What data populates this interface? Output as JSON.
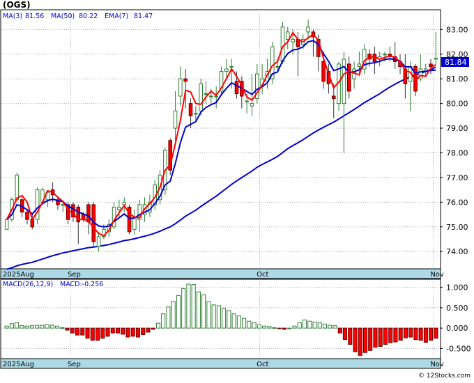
{
  "header": {
    "ticker": "(OGS)",
    "legend": [
      "MA(3)",
      "81.56",
      "MA(50)",
      "80.22",
      "EMA(7)",
      "81.47"
    ]
  },
  "price_badge": "81.84",
  "macd_legend": [
    "MACD(26,12,9)",
    "MACD:-0.256"
  ],
  "watermark": "© 12Stocks.com",
  "colors": {
    "ma3": "#ff0000",
    "ma50": "#0000cc",
    "ema7": "#0000cc",
    "up": "#2e7d32",
    "down": "#ff0000",
    "badge": "#0000cc",
    "band": "#add8e6"
  },
  "chart_data": [
    {
      "type": "candlestick",
      "title": "(OGS)",
      "x_labels": [
        "2025Aug",
        "Sep",
        "Oct",
        "Nov"
      ],
      "ylim": [
        73.3,
        83.8
      ],
      "yticks": [
        74.0,
        75.0,
        76.0,
        77.0,
        78.0,
        79.0,
        80.0,
        81.0,
        82.0,
        83.0
      ],
      "grid": true,
      "candles": [
        [
          74.9,
          75.3,
          75.05,
          75.35
        ],
        [
          75.3,
          76.1,
          75.2,
          76.2
        ],
        [
          76.1,
          77.1,
          76.0,
          77.2
        ],
        [
          76.1,
          75.6,
          75.4,
          76.2
        ],
        [
          75.6,
          75.3,
          75.1,
          75.7
        ],
        [
          75.3,
          75.0,
          74.9,
          75.5
        ],
        [
          75.3,
          76.5,
          75.1,
          76.6
        ],
        [
          76.0,
          76.5,
          75.9,
          76.6
        ],
        [
          76.1,
          76.4,
          75.8,
          76.5
        ],
        [
          76.5,
          76.3,
          76.0,
          76.8
        ],
        [
          76.1,
          75.9,
          75.7,
          76.2
        ],
        [
          75.9,
          75.9,
          75.6,
          76.0
        ],
        [
          75.9,
          75.3,
          75.1,
          76.0
        ],
        [
          75.9,
          75.4,
          75.2,
          76.0
        ],
        [
          75.8,
          75.2,
          74.3,
          75.9
        ],
        [
          75.5,
          75.3,
          75.2,
          75.6
        ],
        [
          75.9,
          75.2,
          74.7,
          76.0
        ],
        [
          75.9,
          74.4,
          74.2,
          76.0
        ],
        [
          74.2,
          74.6,
          74.0,
          74.8
        ],
        [
          74.6,
          74.9,
          74.5,
          75.1
        ],
        [
          74.8,
          75.1,
          74.6,
          75.3
        ],
        [
          75.0,
          75.8,
          74.9,
          76.0
        ],
        [
          75.7,
          75.8,
          75.4,
          76.1
        ],
        [
          75.9,
          76.0,
          75.6,
          76.2
        ],
        [
          75.8,
          74.8,
          74.7,
          75.9
        ],
        [
          74.9,
          75.4,
          74.7,
          75.7
        ],
        [
          75.3,
          75.9,
          74.8,
          76.1
        ],
        [
          75.5,
          75.9,
          75.2,
          76.2
        ],
        [
          75.6,
          76.0,
          75.4,
          76.3
        ],
        [
          75.9,
          76.7,
          75.7,
          76.9
        ],
        [
          76.1,
          77.1,
          75.9,
          77.3
        ],
        [
          76.5,
          78.1,
          76.3,
          78.2
        ],
        [
          78.5,
          77.3,
          77.1,
          78.6
        ],
        [
          79.0,
          79.7,
          78.5,
          80.5
        ],
        [
          80.3,
          81.0,
          79.9,
          81.5
        ],
        [
          81.0,
          80.9,
          79.8,
          81.4
        ],
        [
          80.0,
          79.5,
          79.0,
          80.2
        ],
        [
          79.6,
          79.6,
          79.3,
          79.9
        ],
        [
          79.7,
          80.8,
          79.5,
          81.0
        ],
        [
          80.4,
          80.4,
          80.0,
          80.9
        ],
        [
          80.3,
          80.3,
          80.0,
          80.6
        ],
        [
          80.3,
          80.3,
          79.8,
          80.7
        ],
        [
          80.5,
          81.3,
          80.3,
          81.5
        ],
        [
          81.3,
          81.4,
          81.0,
          81.8
        ],
        [
          81.5,
          81.5,
          80.6,
          81.8
        ],
        [
          80.9,
          80.4,
          80.2,
          81.3
        ],
        [
          80.9,
          80.3,
          79.8,
          81.1
        ],
        [
          80.1,
          80.1,
          79.6,
          80.4
        ],
        [
          79.9,
          80.0,
          79.5,
          81.2
        ],
        [
          80.2,
          81.2,
          80.0,
          81.6
        ],
        [
          80.7,
          81.0,
          80.4,
          81.6
        ],
        [
          80.9,
          81.3,
          80.6,
          81.8
        ],
        [
          81.0,
          82.3,
          80.8,
          82.5
        ],
        [
          81.5,
          81.5,
          81.3,
          81.8
        ],
        [
          81.7,
          83.1,
          81.6,
          83.3
        ],
        [
          82.6,
          82.9,
          82.2,
          83.1
        ],
        [
          82.5,
          82.6,
          82.0,
          83.0
        ],
        [
          82.6,
          82.3,
          81.1,
          82.9
        ],
        [
          82.4,
          82.6,
          82.2,
          82.8
        ],
        [
          82.9,
          83.1,
          82.6,
          83.4
        ],
        [
          82.9,
          82.7,
          81.9,
          83.0
        ],
        [
          82.6,
          81.9,
          81.3,
          82.8
        ],
        [
          81.7,
          80.9,
          80.6,
          82.1
        ],
        [
          81.3,
          80.8,
          80.4,
          81.6
        ],
        [
          80.3,
          80.2,
          79.4,
          80.8
        ],
        [
          80.0,
          81.6,
          79.7,
          81.7
        ],
        [
          80.0,
          81.8,
          78.0,
          82.1
        ],
        [
          81.6,
          80.5,
          80.2,
          81.9
        ],
        [
          81.0,
          81.4,
          80.6,
          81.7
        ],
        [
          81.5,
          81.6,
          81.1,
          82.1
        ],
        [
          81.4,
          82.2,
          81.2,
          82.4
        ],
        [
          82.0,
          81.8,
          81.5,
          82.2
        ],
        [
          82.0,
          81.7,
          81.2,
          82.3
        ],
        [
          81.8,
          81.9,
          81.5,
          82.1
        ],
        [
          82.0,
          82.0,
          81.7,
          82.1
        ],
        [
          82.0,
          81.9,
          81.7,
          82.3
        ],
        [
          81.9,
          81.7,
          81.4,
          82.5
        ],
        [
          81.7,
          81.5,
          81.2,
          82.0
        ],
        [
          81.4,
          80.8,
          80.2,
          82.0
        ],
        [
          80.9,
          81.5,
          79.7,
          81.7
        ],
        [
          81.5,
          80.5,
          80.3,
          81.6
        ],
        [
          81.0,
          81.4,
          80.9,
          82.0
        ],
        [
          81.3,
          81.4,
          81.1,
          81.6
        ],
        [
          81.6,
          81.5,
          81.2,
          81.8
        ],
        [
          81.8,
          81.84,
          81.6,
          82.9
        ]
      ],
      "series": [
        {
          "name": "MA(3)",
          "last": 81.56
        },
        {
          "name": "MA(50)",
          "last": 80.22
        },
        {
          "name": "EMA(7)",
          "last": 81.47
        }
      ],
      "last_close": 81.84
    },
    {
      "type": "bar",
      "title": "MACD(26,12,9)",
      "last_value": -0.256,
      "ylim": [
        -0.75,
        1.2
      ],
      "yticks": [
        1.0,
        0.5,
        0.0,
        -0.5
      ],
      "yticklabels": [
        "1.000",
        "0.500",
        "0.000",
        "-0.500"
      ],
      "x_labels": [
        "2025Aug",
        "Sep",
        "Oct",
        "Nov"
      ],
      "values": [
        0.05,
        0.11,
        0.13,
        0.06,
        0.05,
        0.06,
        0.07,
        0.07,
        0.08,
        0.07,
        0.05,
        0.01,
        -0.05,
        -0.12,
        -0.17,
        -0.17,
        -0.25,
        -0.3,
        -0.3,
        -0.25,
        -0.2,
        -0.12,
        -0.12,
        -0.15,
        -0.22,
        -0.2,
        -0.22,
        -0.16,
        -0.1,
        -0.03,
        0.12,
        0.35,
        0.52,
        0.65,
        0.8,
        0.97,
        1.08,
        1.07,
        0.89,
        0.82,
        0.65,
        0.57,
        0.55,
        0.48,
        0.43,
        0.35,
        0.3,
        0.24,
        0.17,
        0.13,
        0.08,
        0.05,
        0.04,
        0.01,
        -0.01,
        -0.03,
        0.0,
        0.05,
        0.13,
        0.2,
        0.17,
        0.15,
        0.13,
        0.1,
        0.07,
        0.06,
        -0.12,
        -0.28,
        -0.4,
        -0.58,
        -0.67,
        -0.6,
        -0.55,
        -0.47,
        -0.45,
        -0.4,
        -0.36,
        -0.34,
        -0.3,
        -0.24,
        -0.22,
        -0.28,
        -0.3,
        -0.35,
        -0.3,
        -0.25
      ]
    }
  ]
}
